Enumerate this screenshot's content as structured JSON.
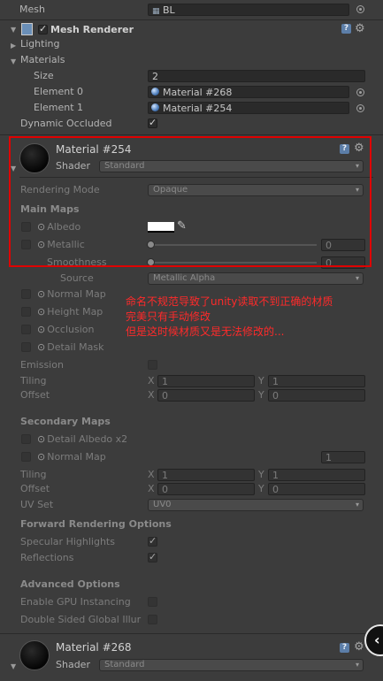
{
  "mesh": {
    "label": "Mesh",
    "value": "BL"
  },
  "mesh_renderer": {
    "title": "Mesh Renderer"
  },
  "lighting": {
    "label": "Lighting"
  },
  "materials": {
    "label": "Materials",
    "size_label": "Size",
    "size_value": "2",
    "element0_label": "Element 0",
    "element0_value": "Material #268",
    "element1_label": "Element 1",
    "element1_value": "Material #254"
  },
  "dynamic_occluded": {
    "label": "Dynamic Occluded"
  },
  "material_254": {
    "title": "Material #254",
    "shader_label": "Shader",
    "shader_value": "Standard",
    "rendering_mode_label": "Rendering Mode",
    "rendering_mode_value": "Opaque",
    "main_maps_label": "Main Maps",
    "albedo_label": "Albedo",
    "metallic_label": "Metallic",
    "metallic_value": "0",
    "smoothness_label": "Smoothness",
    "smoothness_value": "0",
    "source_label": "Source",
    "source_value": "Metallic Alpha",
    "normal_map_label": "Normal Map",
    "height_map_label": "Height Map",
    "occlusion_label": "Occlusion",
    "detail_mask_label": "Detail Mask",
    "emission_label": "Emission",
    "tiling_label": "Tiling",
    "tiling_x": "1",
    "tiling_y": "1",
    "offset_label": "Offset",
    "offset_x": "0",
    "offset_y": "0",
    "secondary_maps_label": "Secondary Maps",
    "detail_albedo_label": "Detail Albedo x2",
    "sec_normal_map_label": "Normal Map",
    "sec_normal_value": "1",
    "sec_tiling_label": "Tiling",
    "sec_tiling_x": "1",
    "sec_tiling_y": "1",
    "sec_offset_label": "Offset",
    "sec_offset_x": "0",
    "sec_offset_y": "0",
    "uv_set_label": "UV Set",
    "uv_set_value": "UV0",
    "forward_label": "Forward Rendering Options",
    "specular_label": "Specular Highlights",
    "reflections_label": "Reflections",
    "advanced_label": "Advanced Options",
    "gpu_instancing_label": "Enable GPU Instancing",
    "double_sided_label": "Double Sided Global Illur"
  },
  "material_268": {
    "title": "Material #268",
    "shader_label": "Shader",
    "shader_value": "Standard"
  },
  "axis": {
    "x": "X",
    "y": "Y"
  },
  "annotation": {
    "line1": "命名不规范导致了unity读取不到正确的材质",
    "line2": "完美只有手动修改",
    "line3": "但是这时候材质又是无法修改的..."
  },
  "icons": {
    "help": "help-icon",
    "gear": "gear-icon",
    "target": "object-picker-icon"
  },
  "colors": {
    "annotation_red": "#e00000",
    "background": "#3c3c3c",
    "help_blue": "#5c7ea8"
  }
}
